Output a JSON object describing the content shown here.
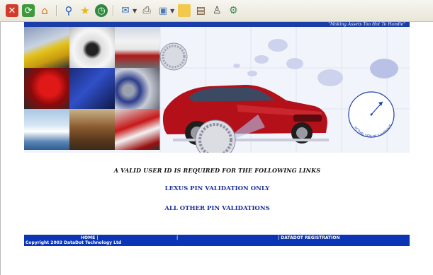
{
  "toolbar": {
    "icons": [
      "stop-icon",
      "refresh-icon",
      "home-icon",
      "search-icon",
      "favorites-icon",
      "history-icon",
      "mail-icon",
      "print-icon",
      "edit-icon",
      "folder-icon",
      "research-icon",
      "messenger-icon",
      "tools-icon"
    ]
  },
  "header": {
    "tagline": "\"Making Assets Too Hot To Handle\""
  },
  "banner": {
    "dial_label": "ACTUAL SIZE OF A DATADOT"
  },
  "main": {
    "requirement_text": "A VALID USER ID IS REQUIRED FOR THE FOLLOWING LINKS",
    "lexus_link": "LEXUS PIN VALIDATION ONLY",
    "other_link": "ALL OTHER PIN VALIDATIONS"
  },
  "footer": {
    "home": "HOME |",
    "divider": "|",
    "registration": "| DATADOT REGISTRATION",
    "copyright": "Copyright 2003 DataDot Technology Ltd"
  },
  "colors": {
    "brand_blue": "#0b35b5",
    "link_blue": "#1b2f9c",
    "car_red": "#b3101a"
  }
}
